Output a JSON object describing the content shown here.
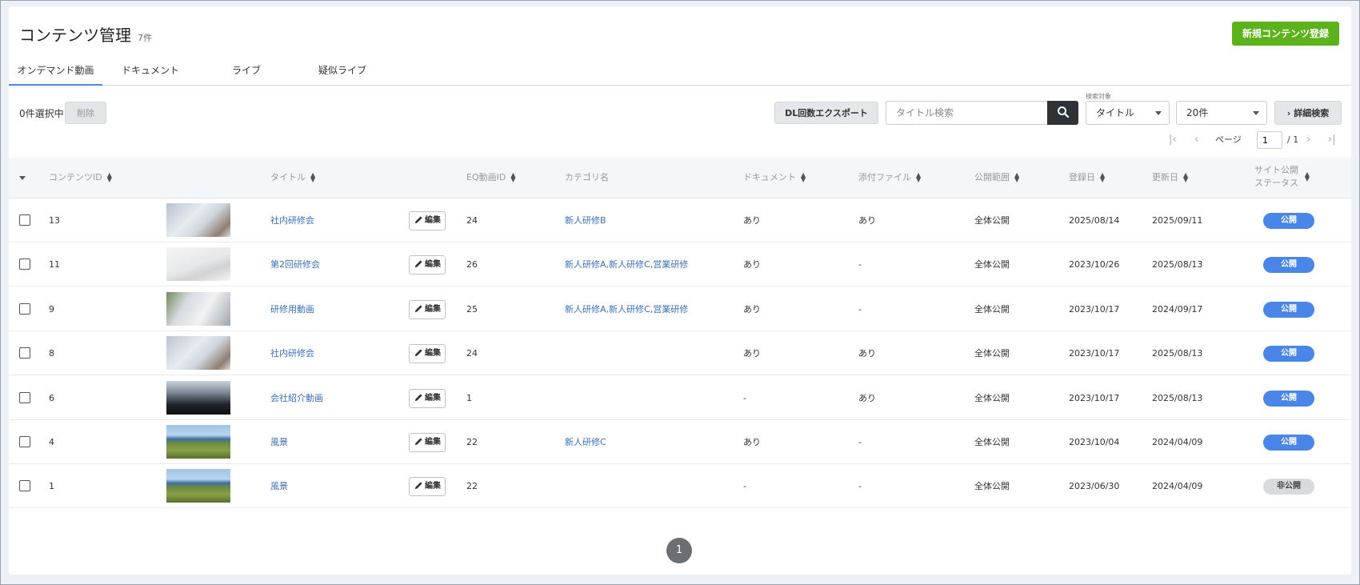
{
  "header": {
    "title": "コンテンツ管理",
    "count": "7件",
    "new_button": "新規コンテンツ登録"
  },
  "tabs": [
    {
      "label": "オンデマンド動画",
      "active": true
    },
    {
      "label": "ドキュメント",
      "active": false
    },
    {
      "label": "ライブ",
      "active": false
    },
    {
      "label": "疑似ライブ",
      "active": false
    }
  ],
  "toolbar": {
    "selected_text": "0件選択中",
    "delete_label": "削除",
    "export_label": "DL回数エクスポート",
    "search_placeholder": "タイトル検索",
    "filter_label": "検索対象",
    "filter_value": "タイトル",
    "page_size": "20件",
    "advanced_label": "詳細検索"
  },
  "pager": {
    "label": "ページ",
    "current": "1",
    "total": "/ 1"
  },
  "columns": {
    "id": "コンテンツID",
    "title": "タイトル",
    "eq_id": "EQ動画ID",
    "category": "カテゴリ名",
    "document": "ドキュメント",
    "attachment": "添付ファイル",
    "scope": "公開範囲",
    "registered": "登録日",
    "updated": "更新日",
    "status_line1": "サイト公開",
    "status_line2": "ステータス"
  },
  "edit_label": "編集",
  "rows": [
    {
      "id": "13",
      "title": "社内研修会",
      "eq_id": "24",
      "category": "新人研修B",
      "document": "あり",
      "attachment": "あり",
      "scope": "全体公開",
      "registered": "2025/08/14",
      "updated": "2025/09/11",
      "status": "公開",
      "thumb": "meeting"
    },
    {
      "id": "11",
      "title": "第2回研修会",
      "eq_id": "26",
      "category": "新人研修A,新人研修C,営業研修",
      "document": "あり",
      "attachment": "-",
      "scope": "全体公開",
      "registered": "2023/10/26",
      "updated": "2025/08/13",
      "status": "公開",
      "thumb": "desk"
    },
    {
      "id": "9",
      "title": "研修用動画",
      "eq_id": "25",
      "category": "新人研修A,新人研修C,営業研修",
      "document": "あり",
      "attachment": "-",
      "scope": "全体公開",
      "registered": "2023/10/17",
      "updated": "2024/09/17",
      "status": "公開",
      "thumb": "office"
    },
    {
      "id": "8",
      "title": "社内研修会",
      "eq_id": "24",
      "category": "",
      "document": "あり",
      "attachment": "あり",
      "scope": "全体公開",
      "registered": "2023/10/17",
      "updated": "2025/08/13",
      "status": "公開",
      "thumb": "meeting"
    },
    {
      "id": "6",
      "title": "会社紹介動画",
      "eq_id": "1",
      "category": "",
      "document": "-",
      "attachment": "あり",
      "scope": "全体公開",
      "registered": "2023/10/17",
      "updated": "2025/08/13",
      "status": "公開",
      "thumb": "window"
    },
    {
      "id": "4",
      "title": "風景",
      "eq_id": "22",
      "category": "新人研修C",
      "document": "あり",
      "attachment": "-",
      "scope": "全体公開",
      "registered": "2023/10/04",
      "updated": "2024/04/09",
      "status": "公開",
      "thumb": "landscape"
    },
    {
      "id": "1",
      "title": "風景",
      "eq_id": "22",
      "category": "",
      "document": "-",
      "attachment": "-",
      "scope": "全体公開",
      "registered": "2023/06/30",
      "updated": "2024/04/09",
      "status": "非公開",
      "thumb": "landscape"
    }
  ],
  "bottom_page": "1",
  "colors": {
    "accent": "#4a86e8",
    "primary_button": "#5cb21a",
    "link": "#3c6fb8",
    "private_badge": "#d8dadd"
  }
}
